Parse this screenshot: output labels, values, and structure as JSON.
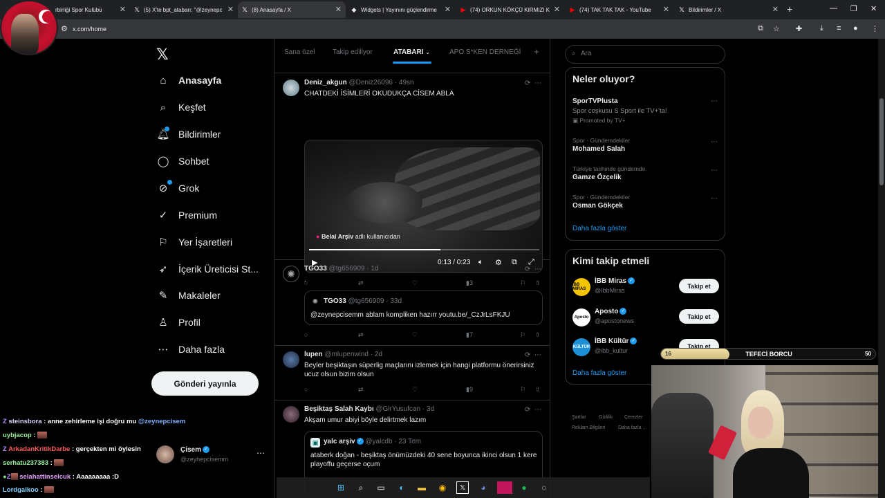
{
  "browser": {
    "tabs": [
      {
        "title": "rbirliği Spor Kulübü",
        "favicon": "x-icon"
      },
      {
        "title": "(5) X'te bpt_atabarı: \"@zeynepc",
        "favicon": "x-icon"
      },
      {
        "title": "(8) Anasayfa / X",
        "favicon": "x-icon",
        "active": true
      },
      {
        "title": "Widgets | Yayınını güçlendirme",
        "favicon": "widgets-icon"
      },
      {
        "title": "(74) ORKUN KÖKÇÜ KIRMIZI K",
        "favicon": "youtube-icon"
      },
      {
        "title": "(74) TAK TAK TAK - YouTube",
        "favicon": "youtube-icon"
      },
      {
        "title": "Bildirimler / X",
        "favicon": "x-icon"
      }
    ],
    "url": "x.com/home"
  },
  "nav": {
    "logo": "𝕏",
    "items": [
      {
        "label": "Anasayfa",
        "icon": "home-icon"
      },
      {
        "label": "Keşfet",
        "icon": "search-icon"
      },
      {
        "label": "Bildirimler",
        "icon": "bell-icon"
      },
      {
        "label": "Sohbet",
        "icon": "chat-icon"
      },
      {
        "label": "Grok",
        "icon": "grok-icon"
      },
      {
        "label": "Premium",
        "icon": "premium-icon"
      },
      {
        "label": "Yer İşaretleri",
        "icon": "bookmark-icon"
      },
      {
        "label": "İçerik Üreticisi St...",
        "icon": "rocket-icon"
      },
      {
        "label": "Makaleler",
        "icon": "article-icon"
      },
      {
        "label": "Profil",
        "icon": "profile-icon"
      },
      {
        "label": "Daha fazla",
        "icon": "more-icon"
      }
    ],
    "post_button": "Gönderi yayınla",
    "account": {
      "name": "Çisem",
      "handle": "@zeynepcisemm"
    }
  },
  "timeline": {
    "tabs": [
      "Sana özel",
      "Takip ediliyor",
      "ATABARI",
      "APO S*KEN DERNEĞİ"
    ],
    "tweets": [
      {
        "name": "Deniz_akgun",
        "handle": "@Deniz26096",
        "time": "49sn",
        "text": "CHATDEKİ İSİMLERİ OKUDUKÇA CİSEM ABLA",
        "video": {
          "attribution_name": "Belal Arşiv",
          "attribution_suffix": "adlı kullanıcıdan",
          "time": "0:13 / 0:23",
          "progress": 0.57
        },
        "views": "3"
      },
      {
        "name": "TGO33",
        "handle": "@tg656909",
        "time": "1d",
        "text": ".",
        "quote": {
          "name": "TGO33",
          "handle": "@tg656909",
          "time": "33d",
          "text": "@zeynepcisemm ablam kompliken hazırr youtu.be/_CzJrLsFKJU"
        },
        "views": "7"
      },
      {
        "name": "lupen",
        "handle": "@mlupenwind",
        "time": "2d",
        "text": "Beyler beşiktaşın süperlig maçlarını izlemek için hangi platformu önerirsiniz ucuz olsun bizim olsun",
        "views": "9"
      },
      {
        "name": "Beşiktaş Salah Kaybı",
        "handle": "@GlrYusufcan",
        "time": "3d",
        "text": "Akşam umur abiyi böyle delirtmek lazım",
        "quote": {
          "name": "yalc arşiv",
          "handle": "@yalcdb",
          "time": "23 Tem",
          "text": "ataberk doğan - beşiktaş önümüzdeki 40 sene boyunca ikinci olsun 1 kere playoffu geçerse oçum"
        }
      }
    ]
  },
  "sidebar": {
    "search_placeholder": "Ara",
    "trends_title": "Neler oluyor?",
    "trends": [
      {
        "category": "",
        "title": "SporTVPlusta",
        "desc": "Spor coşkusu S Sport ile TV+'ta!",
        "promo": "Promoted by TV+"
      },
      {
        "category": "Spor · Gündemdekiler",
        "title": "Mohamed Salah"
      },
      {
        "category": "Türkiye tarihinde gündemde",
        "title": "Gamze Özçelik"
      },
      {
        "category": "Spor · Gündemdekiler",
        "title": "Osman Gökçek"
      }
    ],
    "show_more": "Daha fazla göster",
    "follow_title": "Kimi takip etmeli",
    "follow": [
      {
        "name": "İBB Miras",
        "handle": "@IbbMiras",
        "avatar_text": "İBB MİRAS",
        "avatar_color": "#f5c400"
      },
      {
        "name": "Aposto",
        "handle": "@apostonews",
        "avatar_text": "Aposto",
        "avatar_color": "#ffffff"
      },
      {
        "name": "İBB Kültür",
        "handle": "@ibb_kultur",
        "avatar_text": "KÜLTÜR",
        "avatar_color": "#1c8fd6"
      }
    ],
    "follow_button": "Takip et",
    "footer": [
      "Şartlar",
      "Gizlilik",
      "Çerezler",
      "Reklam Bilgileri",
      "Daha fazla ..."
    ]
  },
  "chat": [
    {
      "user": "steinsbora",
      "msg": ": anne zehirleme işi doğru mu",
      "mention": "@zeynepcisem",
      "color": "#d7d7ff"
    },
    {
      "user": "uybjacop",
      "msg": ":",
      "color": "#9bf0a0"
    },
    {
      "user": "ArkadanKritikDarbe",
      "msg": ": gerçekten mi öylesin",
      "color": "#ff5a5a"
    },
    {
      "user": "serhatu237383",
      "msg": ":",
      "color": "#9bf0a0"
    },
    {
      "user": "selahattinselcuk",
      "msg": ": Aaaaaaaaa :D",
      "color": "#e6a0ff"
    },
    {
      "user": "Lordgalkoo",
      "msg": ":",
      "color": "#7fd1ff"
    }
  ],
  "goal": {
    "label": "TEFECİ BORCU",
    "current": "16",
    "target": "50",
    "progress": 0.32
  },
  "colors": {
    "accent": "#1d9bf0",
    "background": "#000000",
    "border": "#2f3336",
    "muted": "#71767b"
  }
}
